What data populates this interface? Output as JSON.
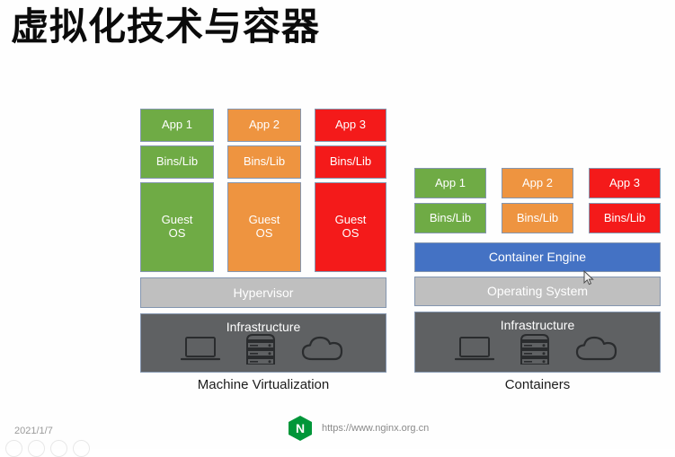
{
  "slide": {
    "title": "虚拟化技术与容器"
  },
  "colors": {
    "green": "#6fab45",
    "orange": "#ee9440",
    "red": "#f41a1a",
    "blue": "#4472c4",
    "gray": "#bfbfbf",
    "dark_gray": "#5f6163",
    "border": "#8496b0",
    "nginx_green": "#009639"
  },
  "left_diagram": {
    "caption": "Machine Virtualization",
    "columns": [
      {
        "app": "App 1",
        "bins": "Bins/Lib",
        "guest_os": "Guest\nOS",
        "color": "green"
      },
      {
        "app": "App 2",
        "bins": "Bins/Lib",
        "guest_os": "Guest\nOS",
        "color": "orange"
      },
      {
        "app": "App 3",
        "bins": "Bins/Lib",
        "guest_os": "Guest\nOS",
        "color": "red"
      }
    ],
    "apps": {
      "a1": "App 1",
      "a2": "App 2",
      "a3": "App 3"
    },
    "bins": {
      "b1": "Bins/Lib",
      "b2": "Bins/Lib",
      "b3": "Bins/Lib"
    },
    "guest": {
      "g1_line1": "Guest",
      "g1_line2": "OS",
      "g2_line1": "Guest",
      "g2_line2": "OS",
      "g3_line1": "Guest",
      "g3_line2": "OS"
    },
    "hypervisor": "Hypervisor",
    "infrastructure": "Infrastructure",
    "infra_icons": [
      "laptop-icon",
      "server-rack-icon",
      "cloud-icon"
    ]
  },
  "right_diagram": {
    "caption": "Containers",
    "columns": [
      {
        "app": "App 1",
        "bins": "Bins/Lib",
        "color": "green"
      },
      {
        "app": "App 2",
        "bins": "Bins/Lib",
        "color": "orange"
      },
      {
        "app": "App 3",
        "bins": "Bins/Lib",
        "color": "red"
      }
    ],
    "apps": {
      "a1": "App 1",
      "a2": "App 2",
      "a3": "App 3"
    },
    "bins": {
      "b1": "Bins/Lib",
      "b2": "Bins/Lib",
      "b3": "Bins/Lib"
    },
    "container_engine": "Container Engine",
    "operating_system": "Operating System",
    "infrastructure": "Infrastructure",
    "infra_icons": [
      "laptop-icon",
      "server-rack-icon",
      "cloud-icon"
    ]
  },
  "footer": {
    "date": "2021/1/7",
    "url": "https://www.nginx.org.cn",
    "logo_letter": "N",
    "logo_name": "nginx-logo"
  }
}
